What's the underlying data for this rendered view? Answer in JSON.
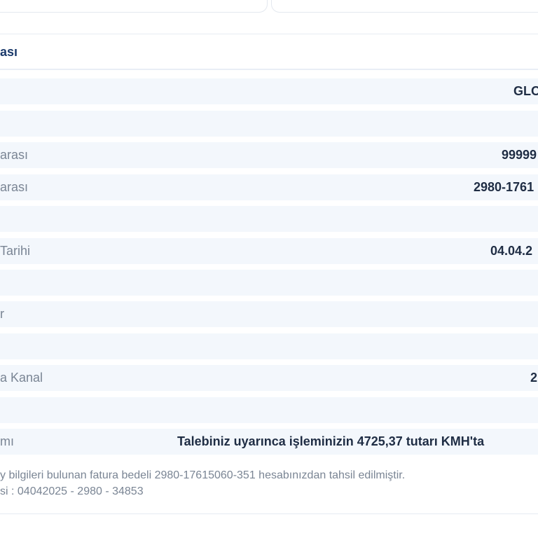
{
  "panel": {
    "title": "ası"
  },
  "rows": [
    {
      "label": "",
      "value": "GLO"
    },
    {
      "label": "",
      "value": ""
    },
    {
      "label": "arası",
      "value": "99999"
    },
    {
      "label": "arası",
      "value": "2980-1761"
    },
    {
      "label": "",
      "value": ""
    },
    {
      "label": "Tarihi",
      "value": "04.04.2"
    },
    {
      "label": "",
      "value": ""
    },
    {
      "label": "r",
      "value": ""
    },
    {
      "label": "",
      "value": ""
    },
    {
      "label": "a Kanal",
      "value": "2"
    },
    {
      "label": "",
      "value": ""
    },
    {
      "label": "mı",
      "value": "Talebiniz uyarınca işleminizin 4725,37 tutarı KMH'ta"
    }
  ],
  "footer": {
    "line1": "y bilgileri bulunan fatura bedeli 2980-17615060-351 hesabınızdan tahsil edilmiştir.",
    "line2": "si : 04042025 - 2980 - 34853"
  }
}
